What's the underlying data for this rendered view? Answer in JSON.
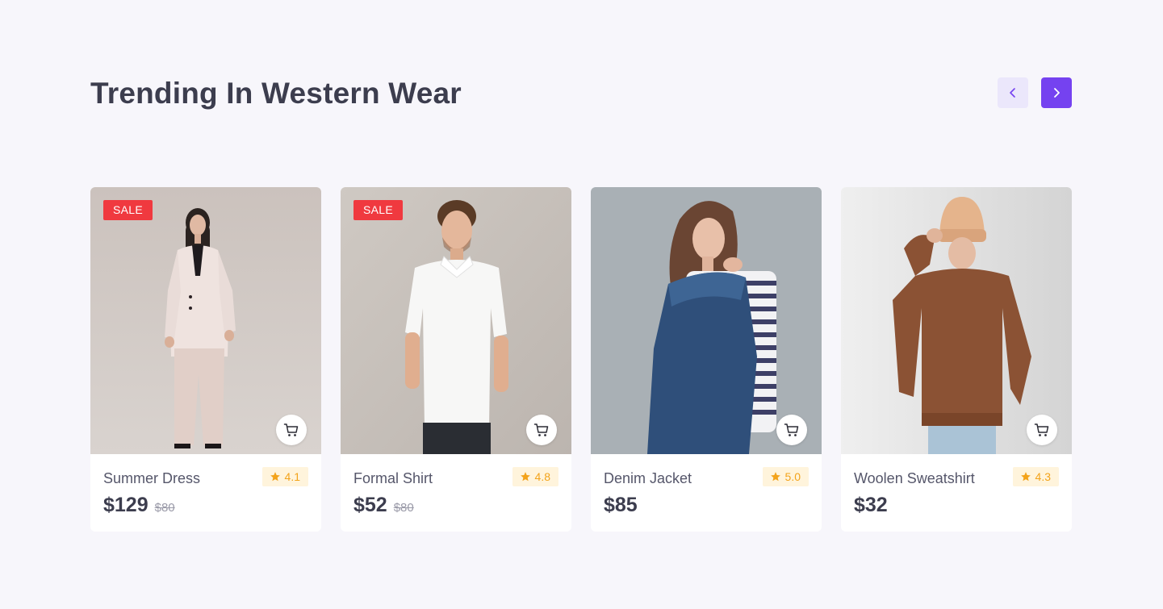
{
  "section": {
    "title": "Trending In Western Wear"
  },
  "navigation": {
    "prev_icon": "chevron-left-icon",
    "next_icon": "chevron-right-icon"
  },
  "colors": {
    "accent": "#7542f0",
    "sale_badge": "#f0393f",
    "rating_text": "#f3a31a",
    "rating_bg": "#fff4dc"
  },
  "products": [
    {
      "name": "Summer Dress",
      "price": "$129",
      "old_price": "$80",
      "rating": "4.1",
      "badge": "SALE",
      "cart_icon": "shopping-cart-icon"
    },
    {
      "name": "Formal Shirt",
      "price": "$52",
      "old_price": "$80",
      "rating": "4.8",
      "badge": "SALE",
      "cart_icon": "shopping-cart-icon"
    },
    {
      "name": "Denim Jacket",
      "price": "$85",
      "old_price": "",
      "rating": "5.0",
      "badge": "",
      "cart_icon": "shopping-cart-icon"
    },
    {
      "name": "Woolen Sweatshirt",
      "price": "$32",
      "old_price": "",
      "rating": "4.3",
      "badge": "",
      "cart_icon": "shopping-cart-icon"
    }
  ]
}
